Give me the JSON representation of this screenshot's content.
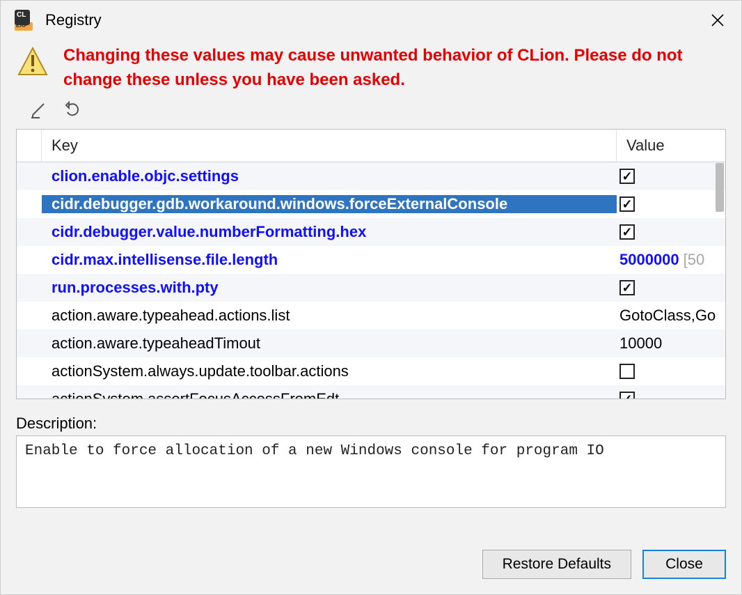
{
  "title": "Registry",
  "warning": "Changing these values may cause unwanted behavior of CLion. Please do not change these unless you have been asked.",
  "columns": {
    "key": "Key",
    "value": "Value"
  },
  "rows": [
    {
      "key": "clion.enable.objc.settings",
      "type": "check",
      "checked": true,
      "modified": true,
      "selected": false
    },
    {
      "key": "cidr.debugger.gdb.workaround.windows.forceExternalConsole",
      "type": "check",
      "checked": true,
      "modified": true,
      "selected": true
    },
    {
      "key": "cidr.debugger.value.numberFormatting.hex",
      "type": "check",
      "checked": true,
      "modified": true,
      "selected": false
    },
    {
      "key": "cidr.max.intellisense.file.length",
      "type": "text",
      "value": "5000000",
      "default": "[50",
      "modified": true,
      "selected": false
    },
    {
      "key": "run.processes.with.pty",
      "type": "check",
      "checked": true,
      "modified": true,
      "selected": false
    },
    {
      "key": "action.aware.typeahead.actions.list",
      "type": "text",
      "value": "GotoClass,Go",
      "modified": false,
      "selected": false
    },
    {
      "key": "action.aware.typeaheadTimout",
      "type": "text",
      "value": "10000",
      "modified": false,
      "selected": false
    },
    {
      "key": "actionSystem.always.update.toolbar.actions",
      "type": "check",
      "checked": false,
      "modified": false,
      "selected": false
    },
    {
      "key": "actionSystem.assertFocusAccessFromEdt",
      "type": "check",
      "checked": true,
      "modified": false,
      "selected": false
    }
  ],
  "description_label": "Description:",
  "description": "Enable to force allocation of a new Windows console for program IO",
  "buttons": {
    "restore": "Restore Defaults",
    "close": "Close"
  }
}
